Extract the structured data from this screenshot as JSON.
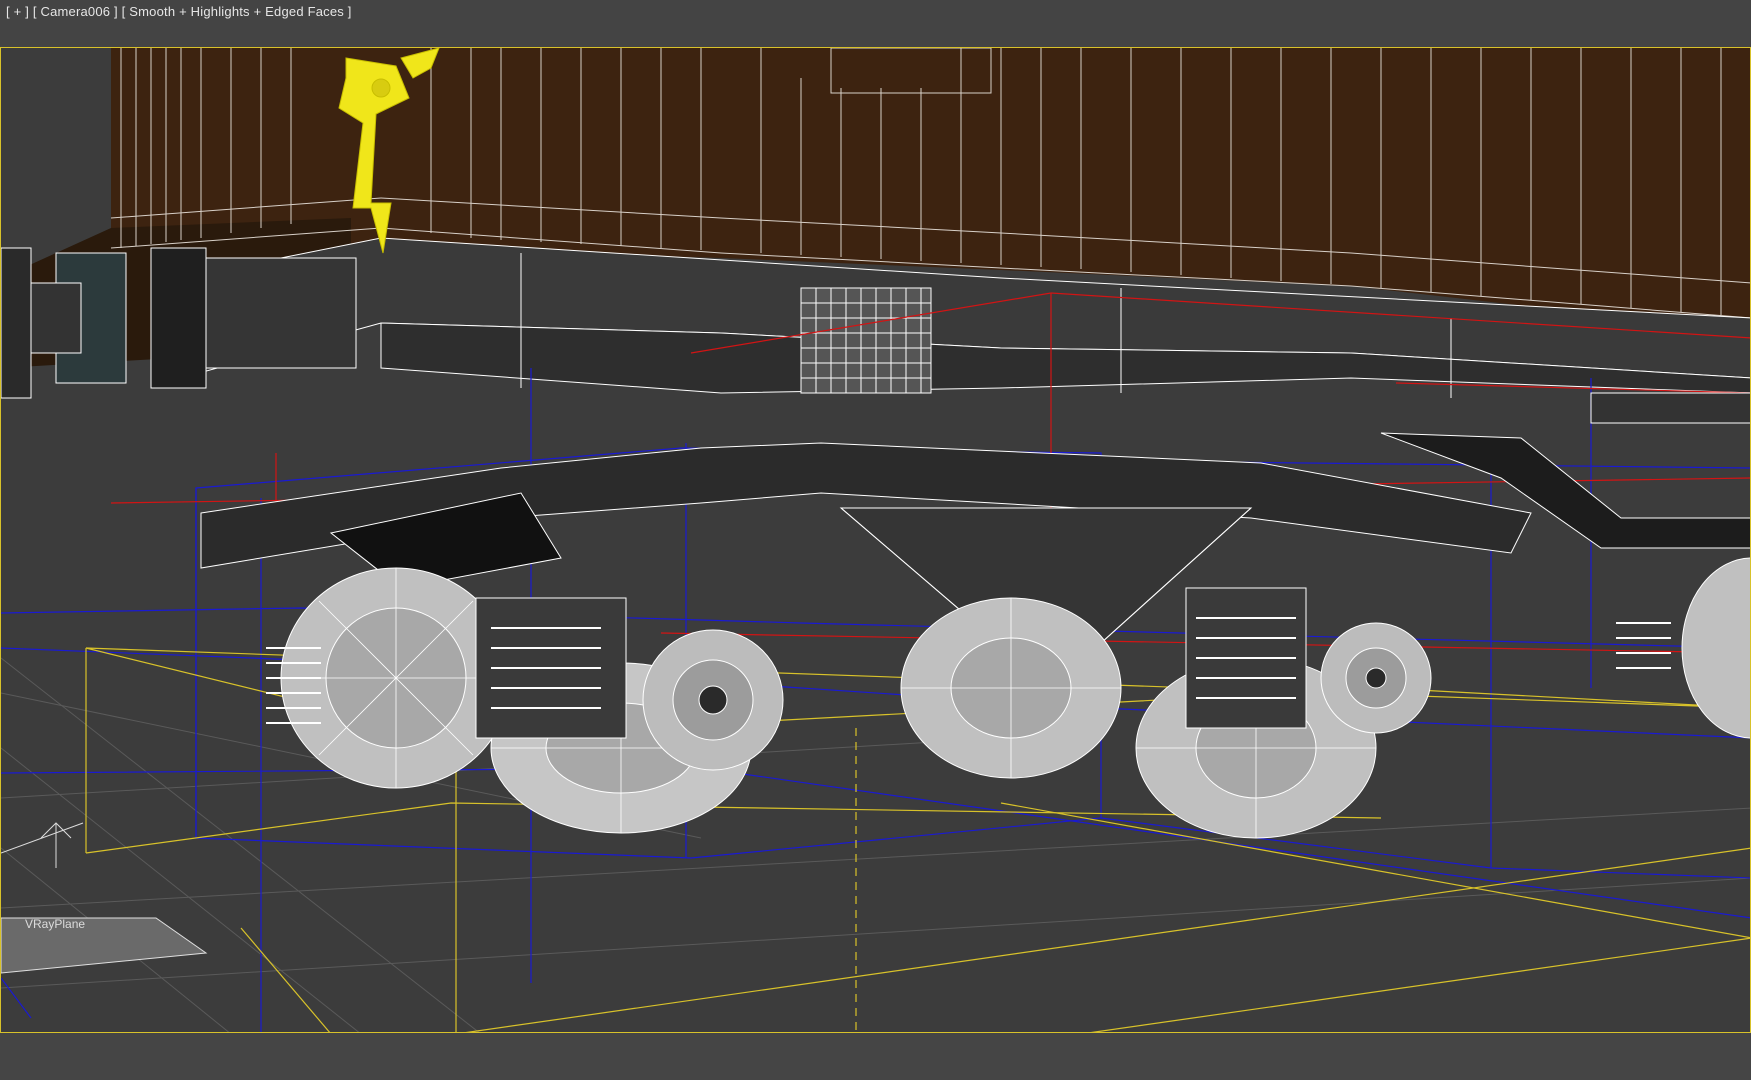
{
  "viewport": {
    "label": "[ + ] [ Camera006 ] [ Smooth + Highlights + Edged Faces ]",
    "object_label": "VRayPlane"
  },
  "colors": {
    "background": "#444444",
    "viewport_fill": "#3c3c3c",
    "active_border": "#d8c22a",
    "car_body": "#3d2310",
    "wire": "#ffffff",
    "selection_yellow": "#f0e61a",
    "bbox_blue": "#1a1ad2",
    "bbox_yellow": "#d8c22a",
    "axis_red": "#d21414"
  },
  "icons": [
    "axis-gizmo-icon"
  ]
}
